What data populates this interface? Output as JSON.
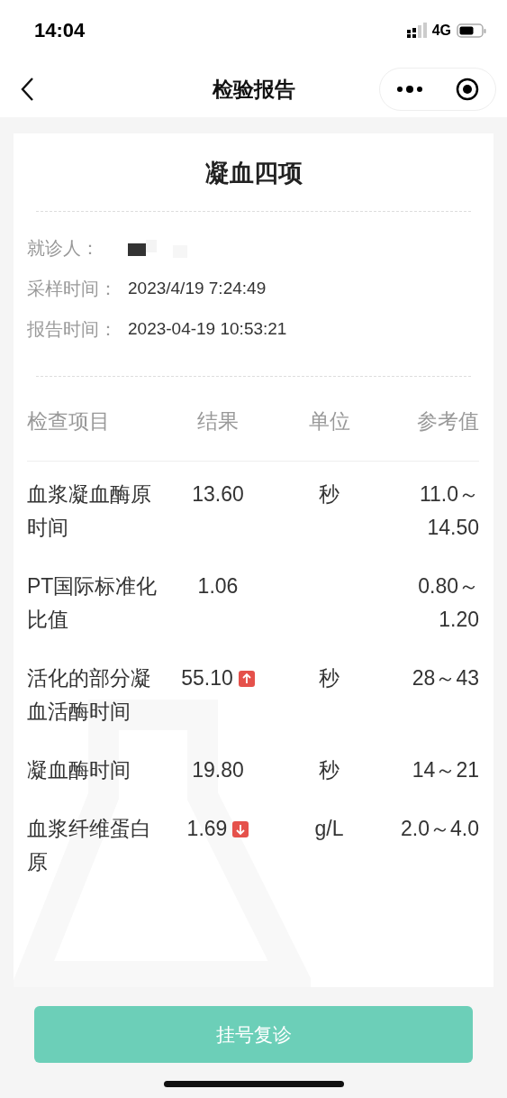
{
  "status_bar": {
    "time": "14:04",
    "network": "4G"
  },
  "nav": {
    "title": "检验报告"
  },
  "report": {
    "title": "凝血四项",
    "info": [
      {
        "label": "就诊人：",
        "redacted": true
      },
      {
        "label": "采样时间：",
        "value": "2023/4/19 7:24:49"
      },
      {
        "label": "报告时间：",
        "value": "2023-04-19 10:53:21"
      }
    ],
    "columns": [
      "检查项目",
      "结果",
      "单位",
      "参考值"
    ],
    "rows": [
      {
        "item": "血浆凝血酶原时间",
        "result": "13.60",
        "unit": "秒",
        "reference": "11.0～14.50",
        "high": false,
        "low": false
      },
      {
        "item": "PT国际标准化比值",
        "result": "1.06",
        "reference": "0.80～1.20",
        "high": false,
        "low": false
      },
      {
        "item": "活化的部分凝血活酶时间",
        "result": "55.10",
        "unit": "秒",
        "reference": "28～43",
        "high": true,
        "low": false
      },
      {
        "item": "凝血酶时间",
        "result": "19.80",
        "unit": "秒",
        "reference": "14～21",
        "high": false,
        "low": false
      },
      {
        "item": "血浆纤维蛋白原",
        "result": "1.69",
        "unit": "g/L",
        "reference": "2.0～4.0",
        "high": false,
        "low": true
      }
    ]
  },
  "action_button": "挂号复诊"
}
